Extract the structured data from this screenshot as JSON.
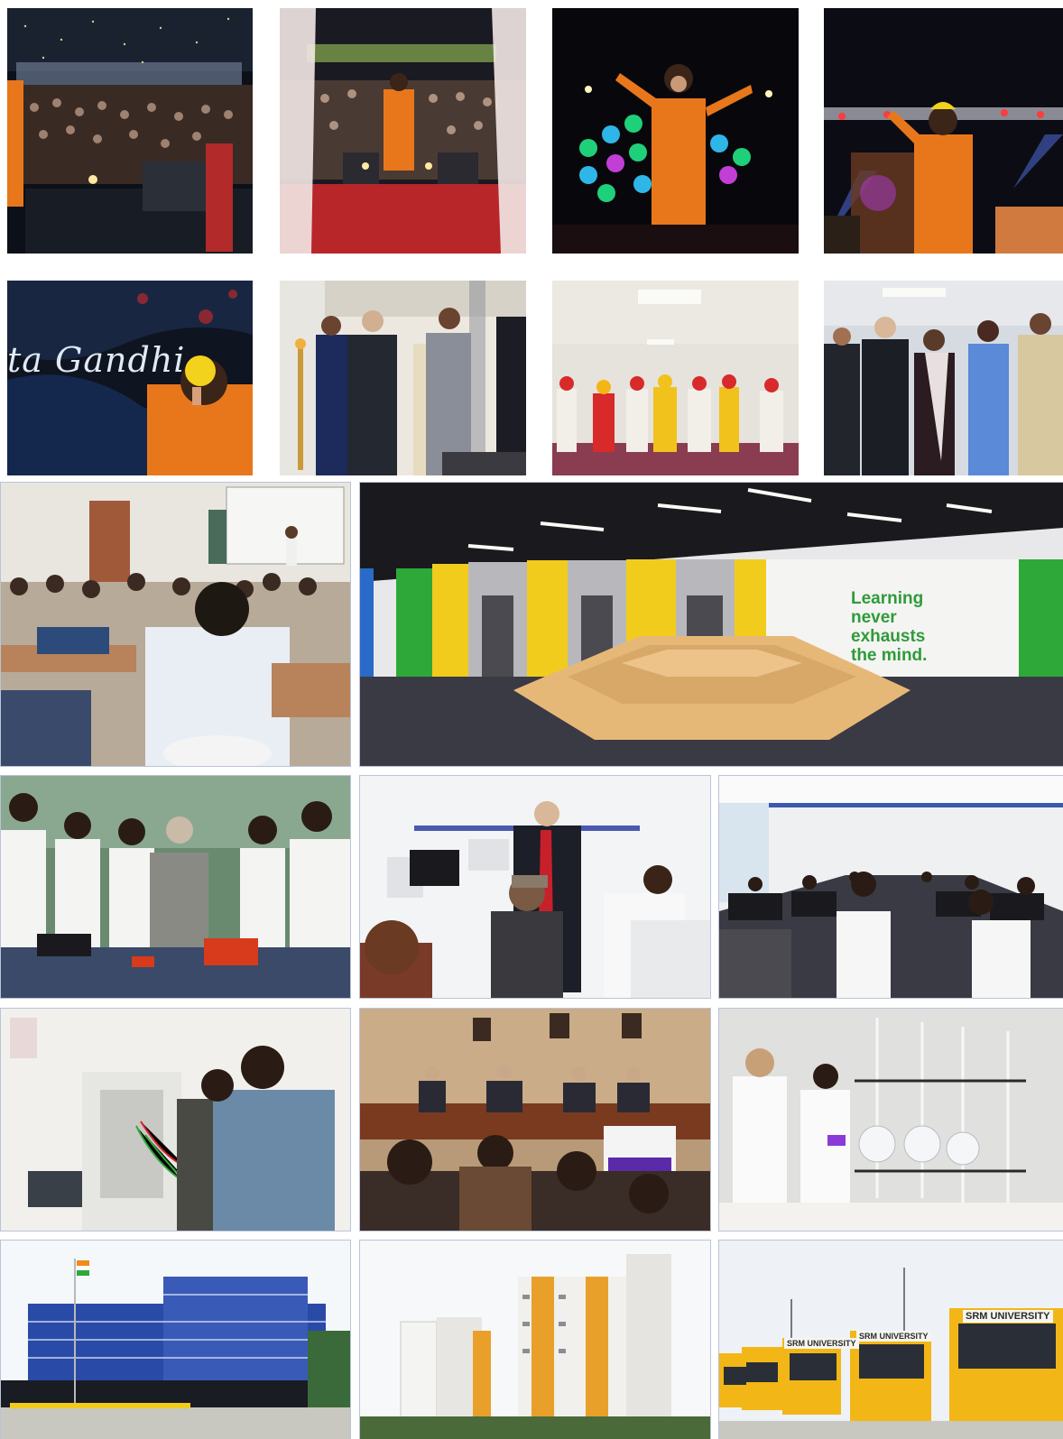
{
  "photos": [
    {
      "id": "concert-crowd"
    },
    {
      "id": "concert-stage-smoke"
    },
    {
      "id": "singer-led-backdrop"
    },
    {
      "id": "singer-stage-lights"
    },
    {
      "id": "singer-name-screen",
      "screen_text": "ta Gandhi"
    },
    {
      "id": "lamp-lighting-ceremony"
    },
    {
      "id": "bhangra-dance"
    },
    {
      "id": "award-group"
    },
    {
      "id": "classroom-lecture"
    },
    {
      "id": "library-lobby",
      "wall_text": [
        "Learning",
        "never",
        "exhausts",
        "the mind."
      ]
    },
    {
      "id": "mechanical-lab"
    },
    {
      "id": "computer-lab-mac"
    },
    {
      "id": "computer-lab-large"
    },
    {
      "id": "electronics-lab"
    },
    {
      "id": "conference-panel"
    },
    {
      "id": "chemistry-lab"
    },
    {
      "id": "campus-building"
    },
    {
      "id": "hostel-towers"
    },
    {
      "id": "bus-fleet",
      "bus_text": [
        "SRM UNIVERSITY",
        "SRM UNIVERSITY",
        "SRM UNIVERSITY"
      ]
    }
  ],
  "colors": {
    "stage_orange": "#e8771c",
    "wall_green": "#2f9b3a",
    "bus_yellow": "#f2b616",
    "frame_border": "#b9c4d6"
  }
}
